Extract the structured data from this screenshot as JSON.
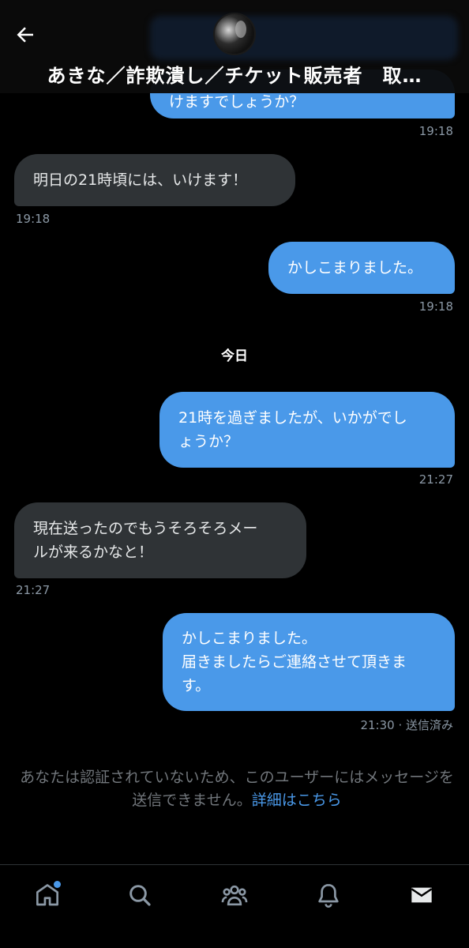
{
  "header": {
    "title": "あきな／詐欺潰し／チケット販売者　取…"
  },
  "messages": [
    {
      "text": "けますでしょうか？",
      "time": "19:18",
      "side": "sent"
    },
    {
      "text": "明日の21時頃には、いけます！",
      "time": "19:18",
      "side": "recv"
    },
    {
      "text": "かしこまりました。",
      "time": "19:18",
      "side": "sent"
    },
    {
      "text": "21時を過ぎましたが、いかがでし\nょうか？",
      "time": "21:27",
      "side": "sent"
    },
    {
      "text": "現在送ったのでもうそろそろメー\nルが来るかなと！",
      "time": "21:27",
      "side": "recv"
    },
    {
      "text": "かしこまりました。\n届きましたらご連絡させて頂きま\nす。",
      "time": "21:30 · 送信済み",
      "side": "sent"
    }
  ],
  "day_separator": "今日",
  "notice": {
    "text": "あなたは認証されていないため、このユーザーにはメッセージを送信できません。",
    "link": "詳細はこちら"
  },
  "tabs": [
    "home-icon",
    "search-icon",
    "communities-icon",
    "notifications-icon",
    "messages-icon"
  ],
  "colors": {
    "sent_bubble": "#4a99e9",
    "recv_bubble": "#2f3336",
    "link": "#4a99e9",
    "background": "#000000"
  }
}
